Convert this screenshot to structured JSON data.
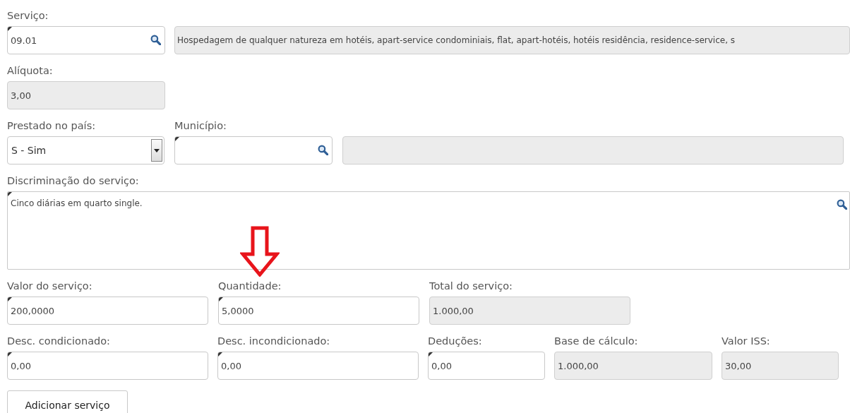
{
  "rows": [
    {
      "fields": [
        {
          "label": "Serviço:",
          "value": "09.01",
          "kind": "lookup",
          "disabled": false,
          "required": true
        },
        {
          "value": "Hospedagem de qualquer natureza em hotéis, apart-service condominiais, flat, apart-hotéis, hotéis residência, residence-service, s",
          "kind": "text",
          "disabled": true,
          "required": false
        }
      ]
    },
    {
      "fields": [
        {
          "label": "Alíquota:",
          "value": "3,00",
          "kind": "text",
          "disabled": true,
          "required": false
        }
      ]
    },
    {
      "fields": [
        {
          "label": "Prestado no país:",
          "value": "S - Sim",
          "kind": "select",
          "disabled": false,
          "required": false
        },
        {
          "label": "Município:",
          "kind": "lookup",
          "disabled": false,
          "required": true
        },
        {
          "kind": "text",
          "disabled": true,
          "required": false
        }
      ]
    },
    {
      "fields": [
        {
          "label": "Discriminação do serviço:",
          "value": "Cinco diárias em quarto single.",
          "kind": "textarea",
          "disabled": false,
          "required": true
        }
      ]
    },
    {
      "fields": [
        {
          "label": "Valor do serviço:",
          "value": "200,0000",
          "kind": "text",
          "disabled": false,
          "required": true
        },
        {
          "label": "Quantidade:",
          "value": "5,0000",
          "kind": "text",
          "disabled": false,
          "required": true
        },
        {
          "label": "Total do serviço:",
          "value": "1.000,00",
          "kind": "text",
          "disabled": true,
          "required": false
        }
      ]
    },
    {
      "fields": [
        {
          "label": "Desc. condicionado:",
          "value": "0,00",
          "kind": "text",
          "disabled": false,
          "required": true
        },
        {
          "label": "Desc. incondicionado:",
          "value": "0,00",
          "kind": "text",
          "disabled": false,
          "required": true
        },
        {
          "label": "Deduções:",
          "value": "0,00",
          "kind": "text",
          "disabled": false,
          "required": true
        },
        {
          "label": "Base de cálculo:",
          "value": "1.000,00",
          "kind": "text",
          "disabled": true,
          "required": false
        },
        {
          "label": "Valor ISS:",
          "value": "30,00",
          "kind": "text",
          "disabled": true,
          "required": false
        }
      ]
    }
  ],
  "button": "Adicionar serviço"
}
